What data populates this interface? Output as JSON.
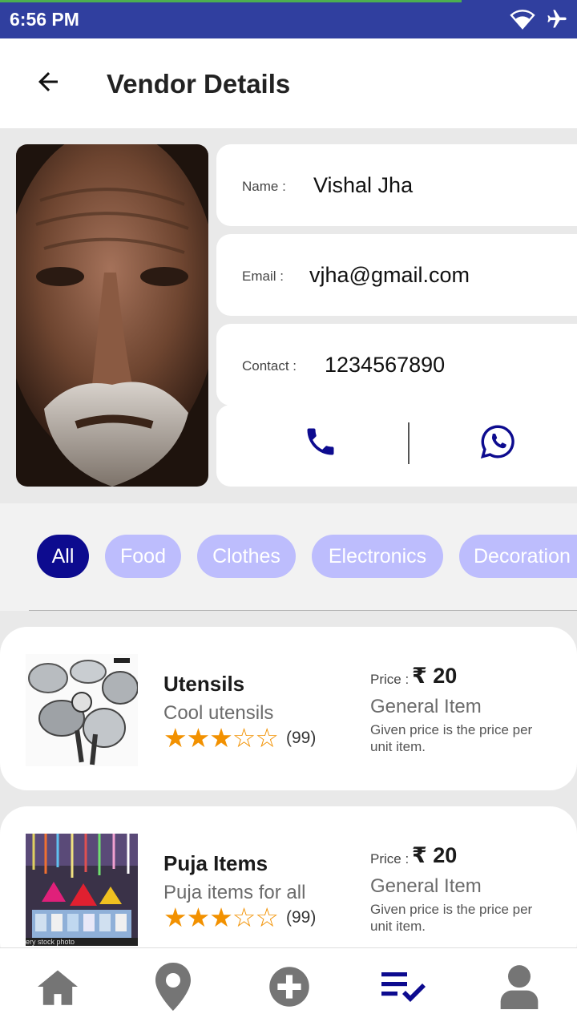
{
  "status_bar": {
    "time": "6:56 PM",
    "icons": [
      "wifi-icon",
      "airplane-icon"
    ],
    "load_progress": 0.8
  },
  "app_bar": {
    "title": "Vendor Details",
    "back_icon": "arrow-left-icon"
  },
  "vendor": {
    "name_label": "Name :",
    "name": "Vishal Jha",
    "email_label": "Email :",
    "email": "vjha@gmail.com",
    "contact_label": "Contact :",
    "contact": "1234567890",
    "actions": [
      "phone-icon",
      "whatsapp-icon"
    ]
  },
  "categories": [
    {
      "label": "All",
      "active": true
    },
    {
      "label": "Food",
      "active": false
    },
    {
      "label": "Clothes",
      "active": false
    },
    {
      "label": "Electronics",
      "active": false
    },
    {
      "label": "Decoration",
      "active": false
    }
  ],
  "items": [
    {
      "name": "Utensils",
      "description": "Cool utensils",
      "rating": 3,
      "rating_max": 5,
      "reviews": "(99)",
      "price_label": "Price :",
      "price": "₹ 20",
      "type": "General Item",
      "note": "Given price is the price per unit item."
    },
    {
      "name": "Puja Items",
      "description": "Puja items for all",
      "rating": 3,
      "rating_max": 5,
      "reviews": "(99)",
      "price_label": "Price :",
      "price": "₹ 20",
      "type": "General Item",
      "note": "Given price is the price per unit item.",
      "image_watermark": "ery stock photo"
    }
  ],
  "bottom_nav": [
    {
      "icon": "home-icon",
      "active": false
    },
    {
      "icon": "location-pin-icon",
      "active": false
    },
    {
      "icon": "add-circle-icon",
      "active": false
    },
    {
      "icon": "list-check-icon",
      "active": true
    },
    {
      "icon": "person-icon",
      "active": false
    }
  ],
  "colors": {
    "status_bar": "#303f9f",
    "primary": "#0d0b8f",
    "chip_inactive": "#bdbdfd",
    "star": "#f29100",
    "nav_inactive": "#757575"
  }
}
